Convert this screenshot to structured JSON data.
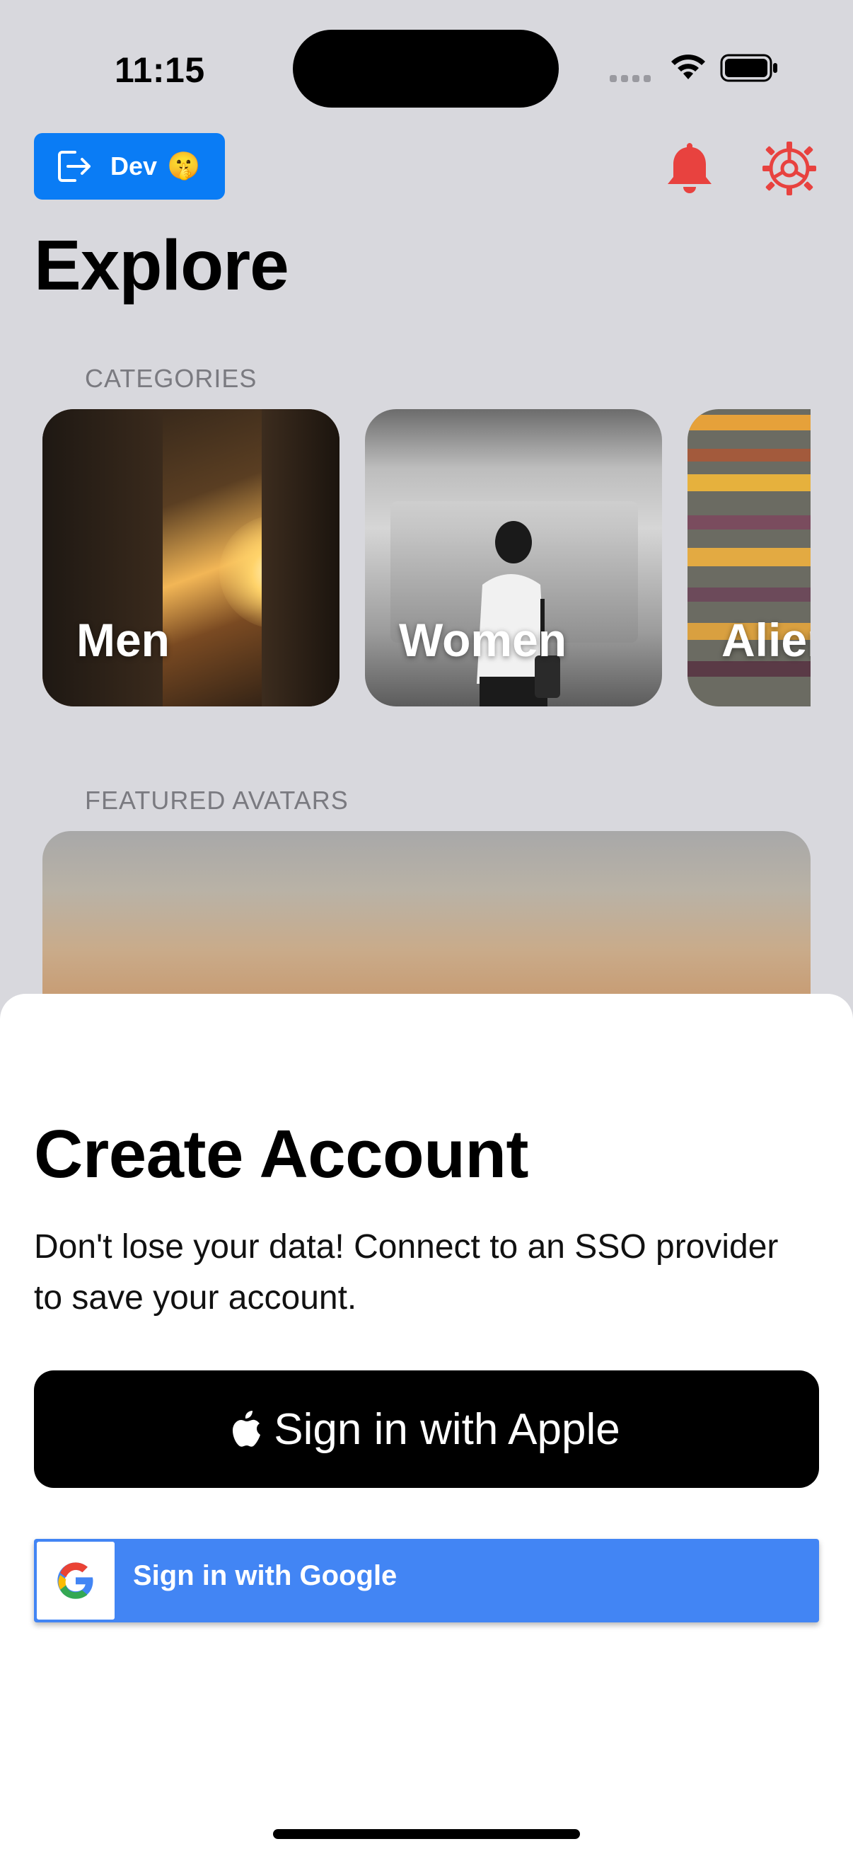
{
  "status_bar": {
    "time": "11:15"
  },
  "header": {
    "dev_button_label": "Dev",
    "dev_button_emoji": "🤫",
    "page_title": "Explore",
    "accent_color": "#e8423f",
    "dev_button_color": "#0a7cf5"
  },
  "categories": {
    "section_label": "CATEGORIES",
    "items": [
      {
        "label": "Men"
      },
      {
        "label": "Women"
      },
      {
        "label": "Alier"
      }
    ]
  },
  "featured": {
    "section_label": "FEATURED AVATARS"
  },
  "create_account_sheet": {
    "title": "Create Account",
    "subtitle": "Don't lose your data! Connect to an SSO provider to save your account.",
    "apple_button_label": "Sign in with Apple",
    "google_button_label": "Sign in with Google",
    "google_color": "#4285f4"
  }
}
